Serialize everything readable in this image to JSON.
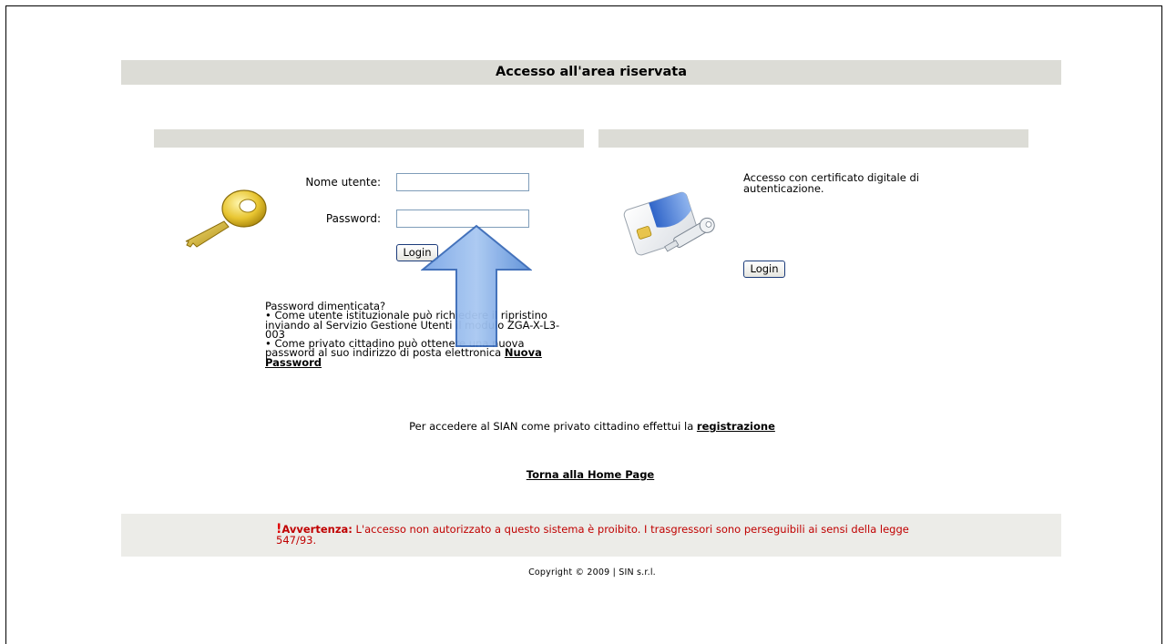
{
  "page": {
    "title": "Accesso all'area riservata"
  },
  "login_form": {
    "username_label": "Nome utente:",
    "password_label": "Password:",
    "username_value": "",
    "password_value": "",
    "login_button": "Login"
  },
  "password_help": {
    "heading": "Password dimenticata?",
    "item1_prefix": "• Come utente istituzionale può",
    "item1_mid": "richiedere il ripristino inviando al Servizio Gestione Utenti il modulo ZGA-X-L3-003",
    "item2_text": "• Come privato cittadino può ottenere una nuova password al suo indirizzo di posta elettronica",
    "new_password_link": "Nuova Password"
  },
  "certificate": {
    "text": "Accesso con certificato digitale di autenticazione.",
    "login_button": "Login"
  },
  "registration": {
    "text": "Per accedere al SIAN come privato cittadino effettui la",
    "link": "registrazione"
  },
  "home_link": "Torna alla Home Page",
  "warning": {
    "label": "Avvertenza:",
    "text": "L'accesso non autorizzato a questo sistema è proibito. I trasgressori sono perseguibili ai sensi della legge 547/93.",
    "icon": "exclamation-icon"
  },
  "copyright": "Copyright © 2009 | SIN s.r.l.",
  "icons": {
    "key": "key-icon",
    "certificate": "smart-card-key-icon",
    "overlay": "up-arrow-icon"
  },
  "colors": {
    "bar": "#dcdcd6",
    "warning_bg": "#ecece8",
    "warning_text": "#c00000",
    "arrow": "#5b8fd8"
  }
}
